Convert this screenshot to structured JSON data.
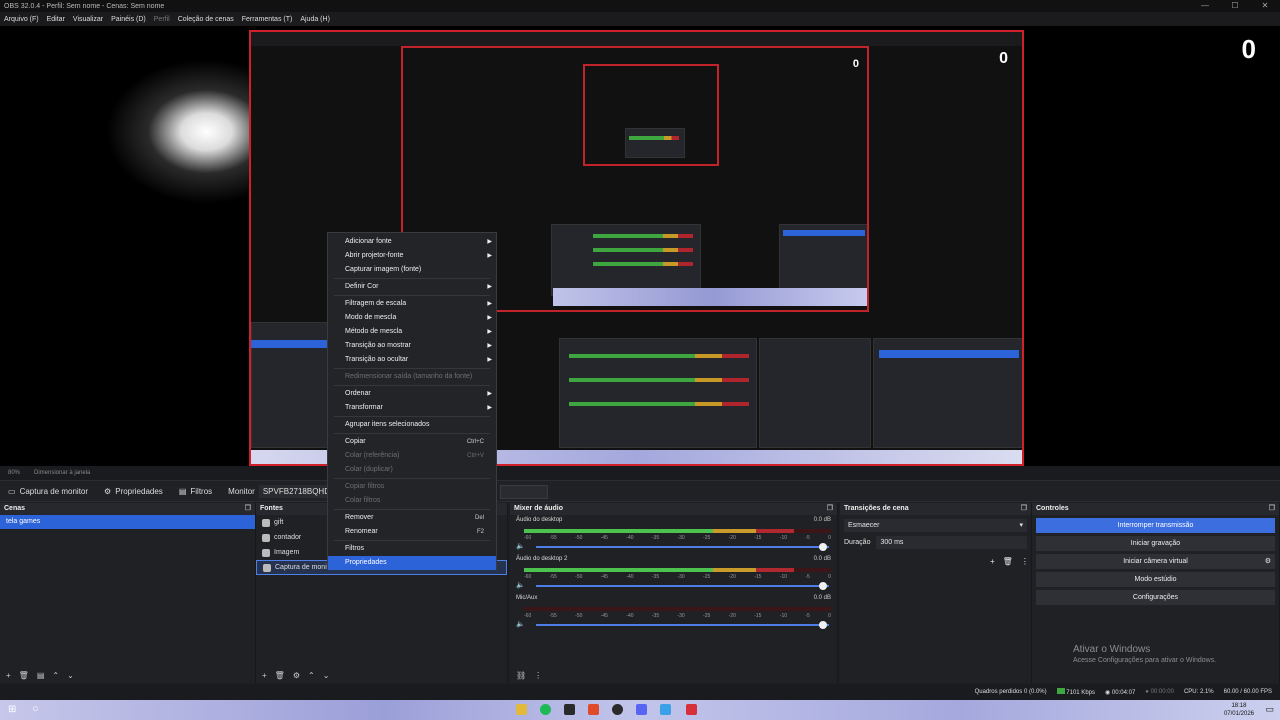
{
  "window": {
    "title": "OBS 32.0.4 - Perfil: Sem nome - Cenas: Sem nome",
    "minimize": "—",
    "maximize": "☐",
    "close": "✕"
  },
  "menubar": [
    "Arquivo (F)",
    "Editar",
    "Visualizar",
    "Painéis (D)",
    "Perfil",
    "Coleção de cenas",
    "Ferramentas (T)",
    "Ajuda (H)"
  ],
  "preview": {
    "counter_text": "0"
  },
  "status_row": {
    "zoom": "80%",
    "scale_mode": "Dimensionar à janela"
  },
  "sourcebar": {
    "selected_source": "Captura de monitor",
    "properties": "Propriedades",
    "filters": "Filtros",
    "monitor_label": "Monitor",
    "monitor_value": "SPVFB2718BQHD: 2560x1"
  },
  "docks": {
    "scenes": {
      "title": "Cenas",
      "items": [
        "tela games"
      ]
    },
    "sources": {
      "title": "Fontes",
      "items": [
        {
          "name": "gift",
          "icon": "image-icon"
        },
        {
          "name": "contador",
          "icon": "text-icon"
        },
        {
          "name": "Imagem",
          "icon": "image-icon"
        },
        {
          "name": "Captura de monitor",
          "icon": "monitor-icon"
        }
      ]
    },
    "mixer": {
      "title": "Mixer de áudio",
      "channels": [
        {
          "name": "Áudio do desktop",
          "db": "0.0 dB"
        },
        {
          "name": "Áudio do desktop 2",
          "db": "0.0 dB"
        },
        {
          "name": "Mic/Aux",
          "db": "0.0 dB"
        }
      ],
      "scale": [
        "-60",
        "-55",
        "-50",
        "-45",
        "-40",
        "-35",
        "-30",
        "-25",
        "-20",
        "-15",
        "-10",
        "-5",
        "0"
      ]
    },
    "transitions": {
      "title": "Transições de cena",
      "selected": "Esmaecer",
      "duration_label": "Duração",
      "duration_value": "300 ms"
    },
    "controls": {
      "title": "Controles",
      "buttons": [
        "Interromper transmissão",
        "Iniciar gravação",
        "Iniciar câmera virtual",
        "Modo estúdio",
        "Configurações"
      ]
    }
  },
  "watermark": {
    "line1": "Ativar o Windows",
    "line2": "Acesse Configurações para ativar o Windows."
  },
  "obs_status": {
    "dropped": "Quadros perdidos 0 (0.0%)",
    "bitrate": "7101 Kbps",
    "stream_time": "00:04:07",
    "rec_time": "00:00:00",
    "cpu": "CPU: 2.1%",
    "fps": "60.00 / 60.00 FPS"
  },
  "context_menu": [
    {
      "label": "Adicionar fonte",
      "submenu": true
    },
    {
      "label": "Abrir projetor-fonte",
      "submenu": true
    },
    {
      "label": "Capturar imagem (fonte)"
    },
    {
      "sep": true
    },
    {
      "label": "Definir Cor",
      "submenu": true
    },
    {
      "sep": true
    },
    {
      "label": "Filtragem de escala",
      "submenu": true
    },
    {
      "label": "Modo de mescla",
      "submenu": true
    },
    {
      "label": "Método de mescla",
      "submenu": true
    },
    {
      "label": "Transição ao mostrar",
      "submenu": true
    },
    {
      "label": "Transição ao ocultar",
      "submenu": true
    },
    {
      "sep": true
    },
    {
      "label": "Redimensionar saída (tamanho da fonte)",
      "disabled": true
    },
    {
      "sep": true
    },
    {
      "label": "Ordenar",
      "submenu": true
    },
    {
      "label": "Transformar",
      "submenu": true
    },
    {
      "sep": true
    },
    {
      "label": "Agrupar itens selecionados"
    },
    {
      "sep": true
    },
    {
      "label": "Copiar",
      "shortcut": "Ctrl+C"
    },
    {
      "label": "Colar (referência)",
      "shortcut": "Ctrl+V",
      "disabled": true
    },
    {
      "label": "Colar (duplicar)",
      "disabled": true
    },
    {
      "sep": true
    },
    {
      "label": "Copiar filtros",
      "disabled": true
    },
    {
      "label": "Colar filtros",
      "disabled": true
    },
    {
      "sep": true
    },
    {
      "label": "Remover",
      "shortcut": "Del"
    },
    {
      "label": "Renomear",
      "shortcut": "F2"
    },
    {
      "sep": true
    },
    {
      "label": "Filtros"
    },
    {
      "label": "Propriedades",
      "highlighted": true
    }
  ],
  "taskbar": {
    "time": "18:18",
    "date": "07/01/2026"
  },
  "colors": {
    "accent": "#2d63d9",
    "preview_border": "#d0202a",
    "meter_green": "#4ec24e",
    "meter_yellow": "#c89b2a",
    "meter_red": "#b02830"
  }
}
